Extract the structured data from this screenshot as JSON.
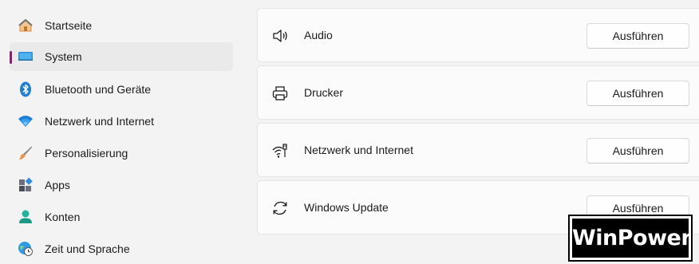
{
  "sidebar": {
    "items": [
      {
        "label": "Startseite",
        "icon": "home-icon"
      },
      {
        "label": "System",
        "icon": "monitor-icon",
        "active": true
      },
      {
        "label": "Bluetooth und Geräte",
        "icon": "bluetooth-icon"
      },
      {
        "label": "Netzwerk und Internet",
        "icon": "wifi-icon"
      },
      {
        "label": "Personalisierung",
        "icon": "brush-icon"
      },
      {
        "label": "Apps",
        "icon": "apps-icon"
      },
      {
        "label": "Konten",
        "icon": "person-icon"
      },
      {
        "label": "Zeit und Sprache",
        "icon": "globe-clock-icon"
      }
    ]
  },
  "main": {
    "cards": [
      {
        "label": "Audio",
        "icon": "speaker-icon",
        "button": "Ausführen"
      },
      {
        "label": "Drucker",
        "icon": "printer-icon",
        "button": "Ausführen"
      },
      {
        "label": "Netzwerk und Internet",
        "icon": "network-icon",
        "button": "Ausführen"
      },
      {
        "label": "Windows Update",
        "icon": "refresh-icon",
        "button": "Ausführen"
      }
    ]
  },
  "watermark": {
    "text": "WinPower"
  },
  "colors": {
    "accent": "#8a1f6e",
    "background": "#f3f3f3",
    "card": "#fbfbfb",
    "active_item": "#eaeaea"
  }
}
